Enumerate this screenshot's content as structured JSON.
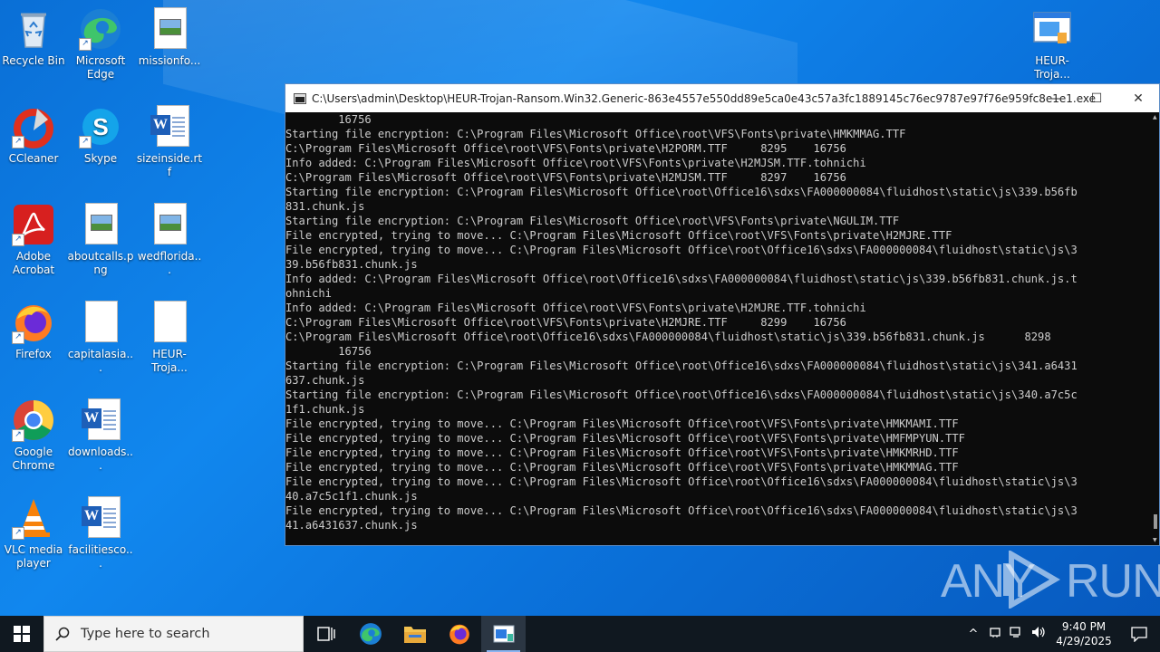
{
  "desktop": {
    "icons": [
      {
        "label": "Recycle Bin"
      },
      {
        "label": "Microsoft Edge"
      },
      {
        "label": "missionfo..."
      },
      {
        "label": "CCleaner"
      },
      {
        "label": "Skype"
      },
      {
        "label": "sizeinside.rtf"
      },
      {
        "label": "Adobe Acrobat"
      },
      {
        "label": "aboutcalls.png"
      },
      {
        "label": "wedflorida..."
      },
      {
        "label": "Firefox"
      },
      {
        "label": "capitalasia..."
      },
      {
        "label": "HEUR-Troja..."
      },
      {
        "label": "Google Chrome"
      },
      {
        "label": "downloads..."
      },
      {
        "label": "VLC media player"
      },
      {
        "label": "facilitiesco..."
      },
      {
        "label": "HEUR-Troja..."
      }
    ]
  },
  "console": {
    "title": "C:\\Users\\admin\\Desktop\\HEUR-Trojan-Ransom.Win32.Generic-863e4557e550dd89e5ca0e43c57a3fc1889145c76ec9787e97f76e959fc8e1e1.exe",
    "minimize": "—",
    "maximize": "☐",
    "close": "✕",
    "lines": [
      "        16756",
      "Starting file encryption: C:\\Program Files\\Microsoft Office\\root\\VFS\\Fonts\\private\\HMKMMAG.TTF",
      "C:\\Program Files\\Microsoft Office\\root\\VFS\\Fonts\\private\\H2PORM.TTF     8295    16756",
      "Info added: C:\\Program Files\\Microsoft Office\\root\\VFS\\Fonts\\private\\H2MJSM.TTF.tohnichi",
      "C:\\Program Files\\Microsoft Office\\root\\VFS\\Fonts\\private\\H2MJSM.TTF     8297    16756",
      "Starting file encryption: C:\\Program Files\\Microsoft Office\\root\\Office16\\sdxs\\FA000000084\\fluidhost\\static\\js\\339.b56fb",
      "831.chunk.js",
      "Starting file encryption: C:\\Program Files\\Microsoft Office\\root\\VFS\\Fonts\\private\\NGULIM.TTF",
      "File encrypted, trying to move... C:\\Program Files\\Microsoft Office\\root\\VFS\\Fonts\\private\\H2MJRE.TTF",
      "File encrypted, trying to move... C:\\Program Files\\Microsoft Office\\root\\Office16\\sdxs\\FA000000084\\fluidhost\\static\\js\\3",
      "39.b56fb831.chunk.js",
      "Info added: C:\\Program Files\\Microsoft Office\\root\\Office16\\sdxs\\FA000000084\\fluidhost\\static\\js\\339.b56fb831.chunk.js.t",
      "ohnichi",
      "Info added: C:\\Program Files\\Microsoft Office\\root\\VFS\\Fonts\\private\\H2MJRE.TTF.tohnichi",
      "C:\\Program Files\\Microsoft Office\\root\\VFS\\Fonts\\private\\H2MJRE.TTF     8299    16756",
      "C:\\Program Files\\Microsoft Office\\root\\Office16\\sdxs\\FA000000084\\fluidhost\\static\\js\\339.b56fb831.chunk.js      8298",
      "        16756",
      "Starting file encryption: C:\\Program Files\\Microsoft Office\\root\\Office16\\sdxs\\FA000000084\\fluidhost\\static\\js\\341.a6431",
      "637.chunk.js",
      "Starting file encryption: C:\\Program Files\\Microsoft Office\\root\\Office16\\sdxs\\FA000000084\\fluidhost\\static\\js\\340.a7c5c",
      "1f1.chunk.js",
      "File encrypted, trying to move... C:\\Program Files\\Microsoft Office\\root\\VFS\\Fonts\\private\\HMKMAMI.TTF",
      "File encrypted, trying to move... C:\\Program Files\\Microsoft Office\\root\\VFS\\Fonts\\private\\HMFMPYUN.TTF",
      "File encrypted, trying to move... C:\\Program Files\\Microsoft Office\\root\\VFS\\Fonts\\private\\HMKMRHD.TTF",
      "File encrypted, trying to move... C:\\Program Files\\Microsoft Office\\root\\VFS\\Fonts\\private\\HMKMMAG.TTF",
      "File encrypted, trying to move... C:\\Program Files\\Microsoft Office\\root\\Office16\\sdxs\\FA000000084\\fluidhost\\static\\js\\3",
      "40.a7c5c1f1.chunk.js",
      "File encrypted, trying to move... C:\\Program Files\\Microsoft Office\\root\\Office16\\sdxs\\FA000000084\\fluidhost\\static\\js\\3",
      "41.a6431637.chunk.js"
    ]
  },
  "watermark": {
    "left": "ANY",
    "right": "RUN"
  },
  "taskbar": {
    "search_placeholder": "Type here to search",
    "time": "9:40 PM",
    "date": "4/29/2025"
  }
}
